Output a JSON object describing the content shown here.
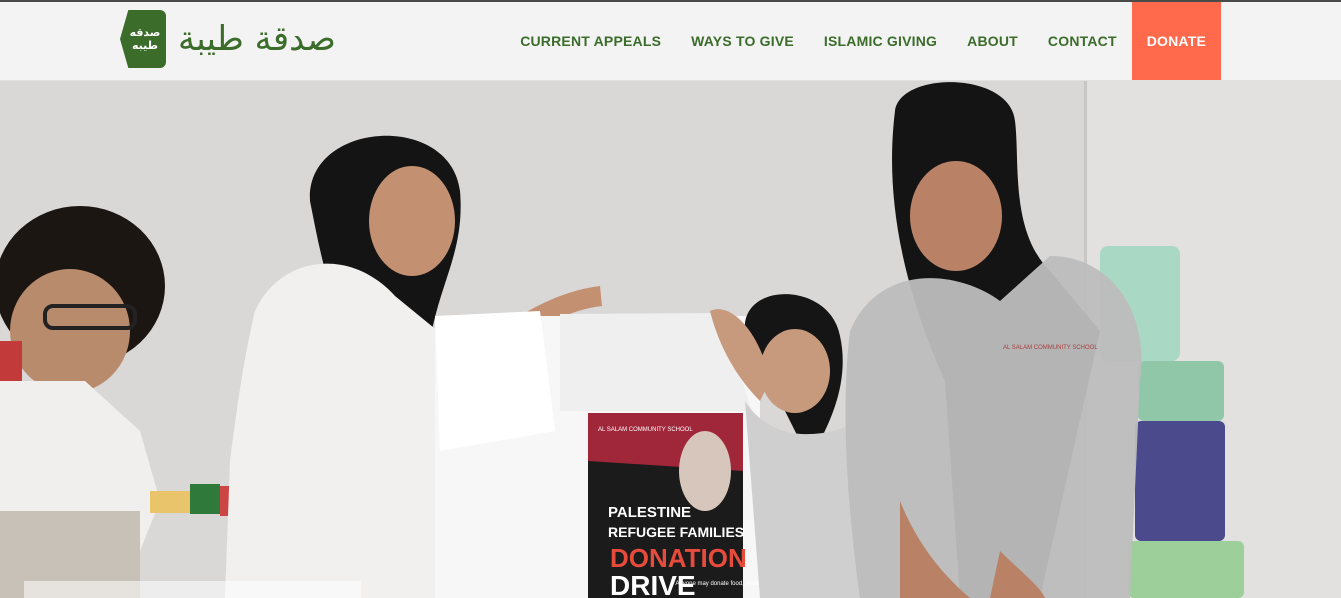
{
  "header": {
    "logo": {
      "badge_line1": "صدقه",
      "badge_line2": "طيبه",
      "wordmark": "صدقة طيبة"
    },
    "nav": [
      {
        "label": "Current Appeals"
      },
      {
        "label": "Ways to Give"
      },
      {
        "label": "Islamic Giving"
      },
      {
        "label": "About"
      },
      {
        "label": "Contact"
      },
      {
        "label": "Donate"
      }
    ]
  },
  "hero": {
    "poster": {
      "school": "AL SALAM COMMUNITY SCHOOL",
      "line1": "PALESTINE",
      "line2": "REFUGEE FAMILIES",
      "line3": "DONATION",
      "line4": "DRIVE",
      "note": "• Anyone may donate food, medical supplies, hygiene"
    },
    "sweatshirt_text": "AL SALAM COMMUNITY SCHOOL"
  },
  "colors": {
    "brand_green": "#3b6c2a",
    "donate_bg": "#ff6a4d",
    "header_bg": "#f3f3f3"
  }
}
